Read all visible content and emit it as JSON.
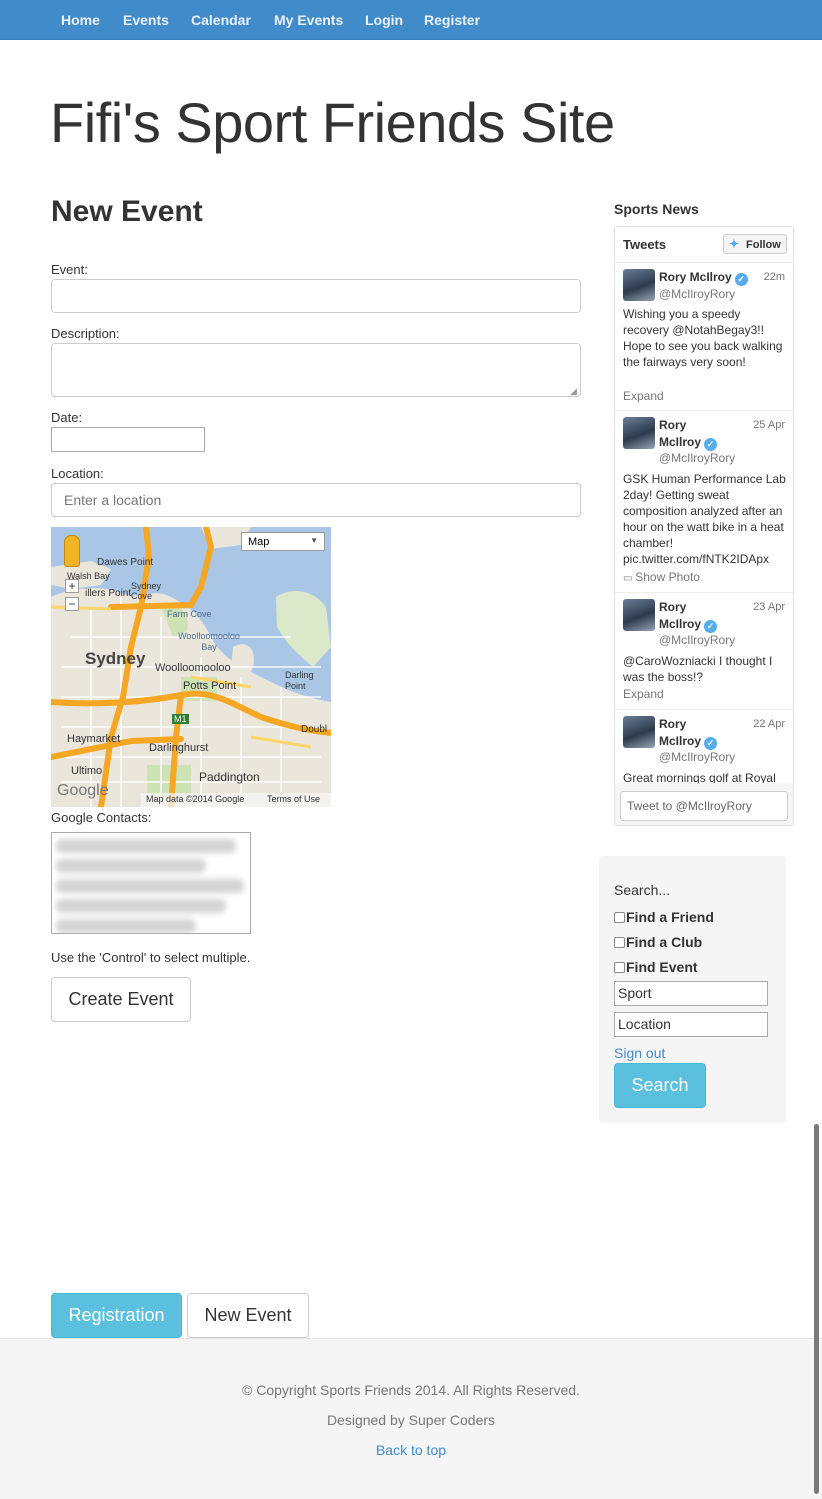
{
  "nav": {
    "items": [
      "Home",
      "Events",
      "Calendar",
      "My Events",
      "Login",
      "Register"
    ]
  },
  "site_title": "Fifi's Sport Friends Site",
  "form": {
    "heading": "New Event",
    "event_label": "Event:",
    "event_value": "",
    "description_label": "Description:",
    "description_value": "",
    "date_label": "Date:",
    "date_value": "",
    "location_label": "Location:",
    "location_placeholder": "Enter a location",
    "map": {
      "type_select": "Map",
      "zoom_in": "+",
      "zoom_out": "−",
      "labels": {
        "sydney": "Sydney",
        "dawes_point": "Dawes Point",
        "sydney_cove": "Sydney Cove",
        "millers_point": "illers Point",
        "walsh_bay": "Walsh Bay",
        "farm_cove": "Farm Cove",
        "woolloomooloo_bay": "Woolloomooloo Bay",
        "woolloomooloo": "Woolloomooloo",
        "potts_point": "Potts Point",
        "darling_point": "Darling Point",
        "haymarket": "Haymarket",
        "darlinghurst": "Darlinghurst",
        "paddington": "Paddington",
        "ultimo": "Ultimo",
        "double_bay": "Doubl",
        "m1": "M1",
        "logo": "Google",
        "map_data": "Map data ©2014 Google",
        "terms": "Terms of Use"
      }
    },
    "contacts_label": "Google Contacts:",
    "hint": "Use the 'Control' to select multiple.",
    "submit_label": "Create Event"
  },
  "twitter": {
    "section_title": "Sports News",
    "header": "Tweets",
    "follow_label": "Follow",
    "compose_placeholder": "Tweet to @McIlroyRory",
    "tweets": [
      {
        "name": "Rory McIlroy",
        "handle": "@McIlroyRory",
        "time": "22m",
        "text": "Wishing you a speedy recovery @NotahBegay3!! Hope to see you back walking the fairways very soon!",
        "action": "Expand"
      },
      {
        "name": "Rory McIlroy",
        "handle": "@McIlroyRory",
        "time": "25 Apr",
        "text": "GSK Human Performance Lab 2day! Getting sweat composition analyzed after an hour on the watt bike in a heat chamber! pic.twitter.com/fNTK2IDApx",
        "action": "Show Photo"
      },
      {
        "name": "Rory McIlroy",
        "handle": "@McIlroyRory",
        "time": "23 Apr",
        "text": "@CaroWozniacki I thought I was the boss!? ",
        "action": "Expand"
      },
      {
        "name": "Rory McIlroy",
        "handle": "@McIlroyRory",
        "time": "22 Apr",
        "text": "Great mornings golf at Royal",
        "action": ""
      }
    ]
  },
  "search": {
    "label": "Search...",
    "checks": [
      "Find a Friend",
      "Find a Club",
      "Find Event"
    ],
    "sport_value": "Sport",
    "location_value": "Location",
    "signout_label": "Sign out",
    "button_label": "Search"
  },
  "bottom_buttons": {
    "registration": "Registration",
    "new_event": "New Event"
  },
  "footer": {
    "copyright": "© Copyright Sports Friends 2014. All Rights Reserved.",
    "designed_by": "Designed by Super Coders",
    "back_to_top": "Back to top"
  }
}
